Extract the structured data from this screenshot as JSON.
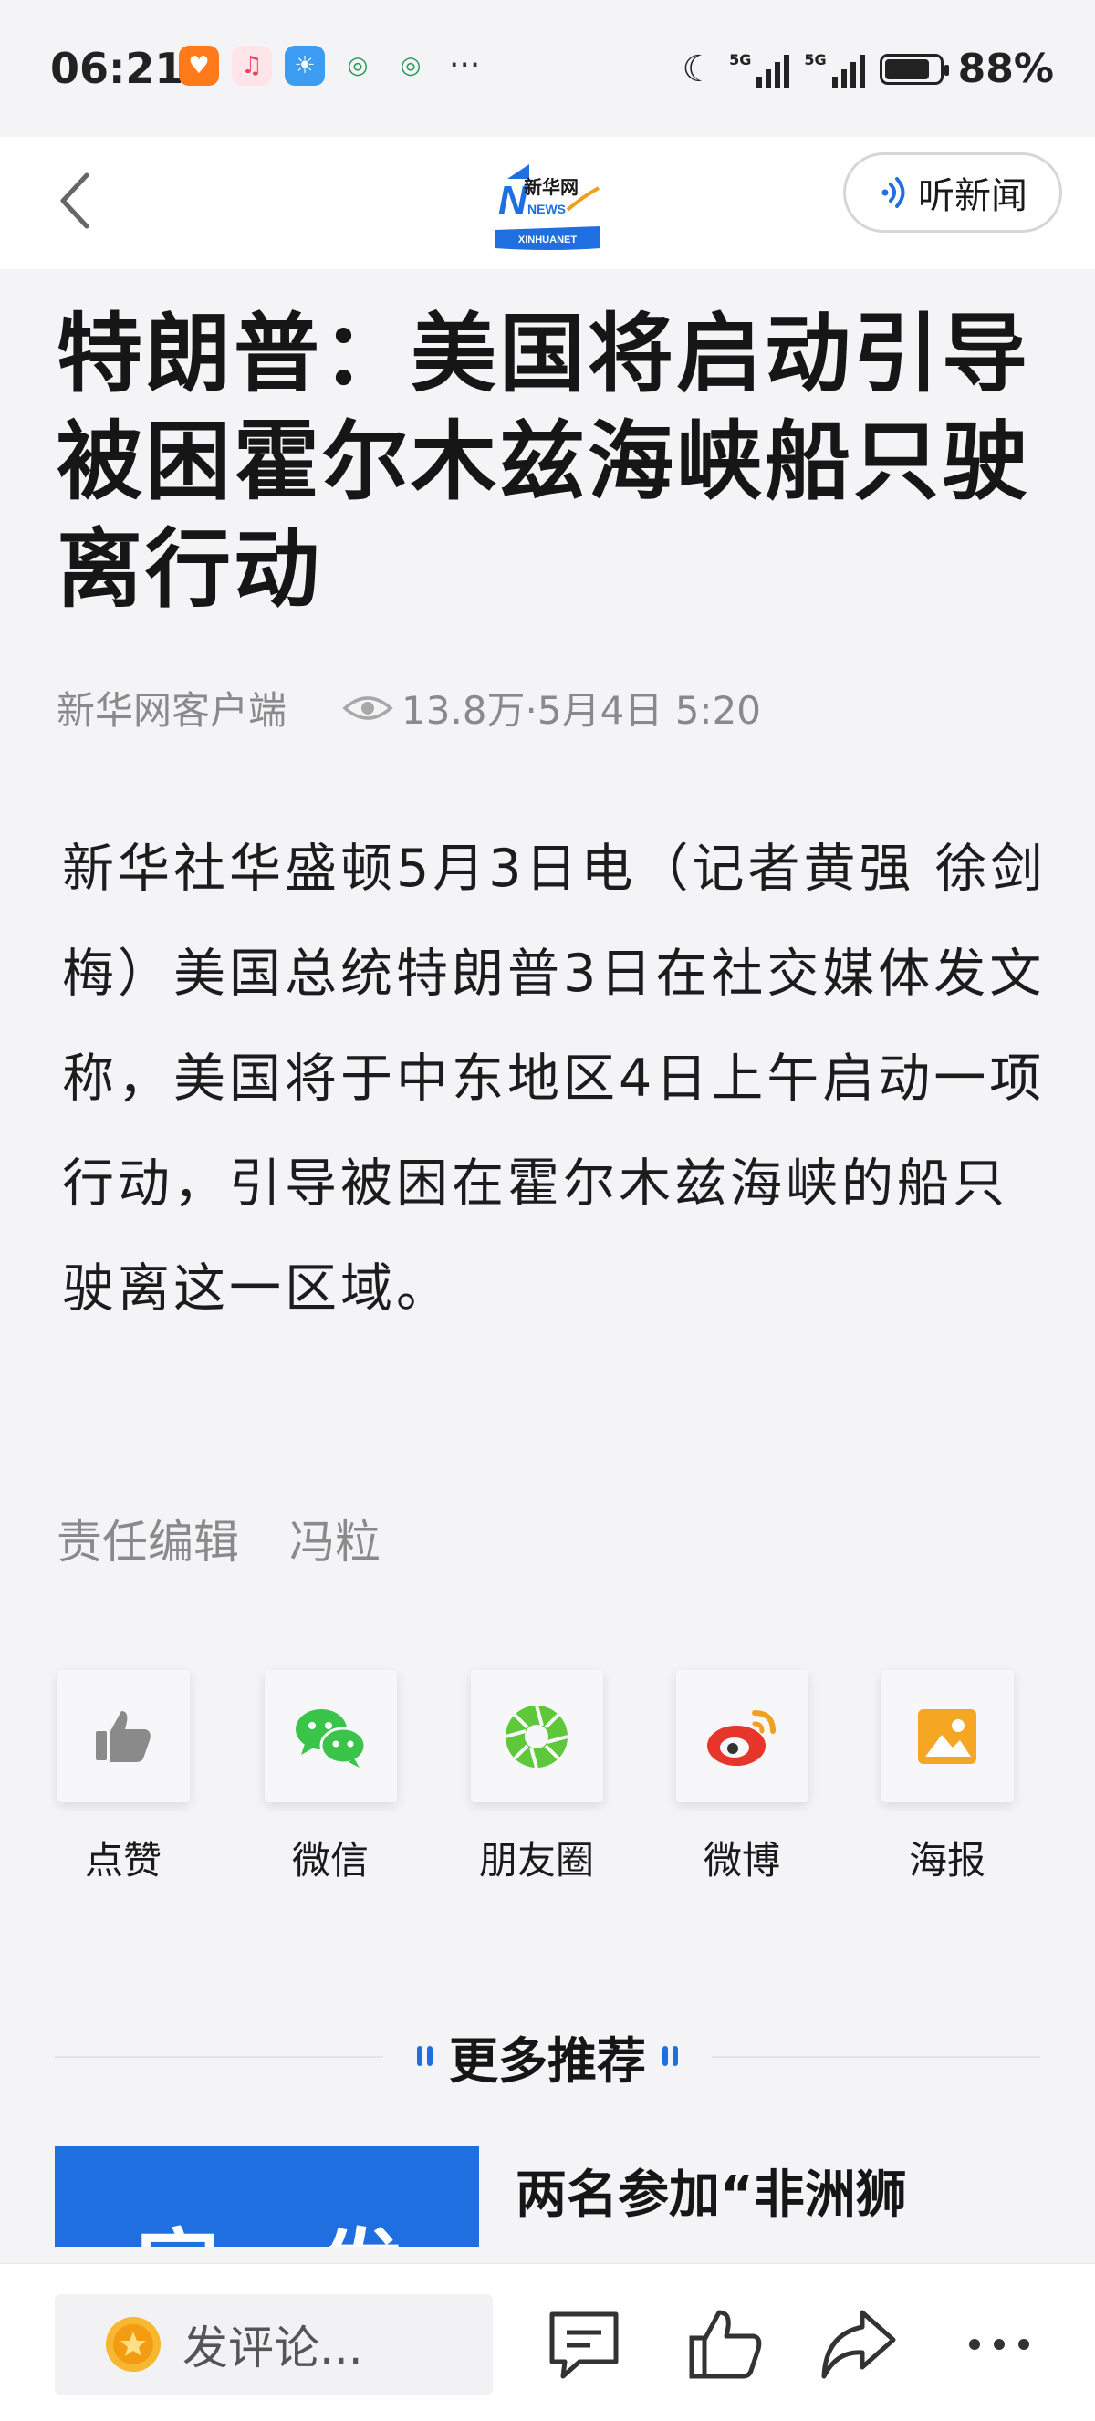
{
  "status_bar": {
    "time": "06:21",
    "network_1": "5G",
    "network_2": "5G",
    "battery": "88%",
    "battery_level": 0.88,
    "more": "···"
  },
  "header": {
    "logo_top": "新华网",
    "logo_news": "NEWS",
    "logo_bottom": "XINHUANET",
    "listen_label": "听新闻"
  },
  "article": {
    "title": "特朗普：美国将启动引导被困霍尔木兹海峡船只驶离行动",
    "source": "新华网客户端",
    "views": "13.8万",
    "date": "·5月4日 5:20",
    "body": "新华社华盛顿5月3日电（记者黄强 徐剑梅）美国总统特朗普3日在社交媒体发文称，美国将于中东地区4日上午启动一项行动，引导被困在霍尔木兹海峡的船只驶离这一区域。",
    "editor_label": "责任编辑",
    "editor_name": "冯粒"
  },
  "share": [
    {
      "label": "点赞",
      "icon": "thumbs-up-icon"
    },
    {
      "label": "微信",
      "icon": "wechat-icon"
    },
    {
      "label": "朋友圈",
      "icon": "moments-icon"
    },
    {
      "label": "微博",
      "icon": "weibo-icon"
    },
    {
      "label": "海报",
      "icon": "poster-icon"
    }
  ],
  "more": {
    "title": "更多推荐",
    "item_title": "两名参加“非洲狮",
    "thumb_text": "官 发"
  },
  "bottom_bar": {
    "comment_placeholder": "发评论...",
    "icons": [
      "comment-icon",
      "like-icon",
      "share-icon",
      "more-icon"
    ]
  },
  "colors": {
    "accent_blue": "#1f6fe0",
    "background": "#f4f4f6",
    "meta_gray": "#8a8a8a"
  }
}
